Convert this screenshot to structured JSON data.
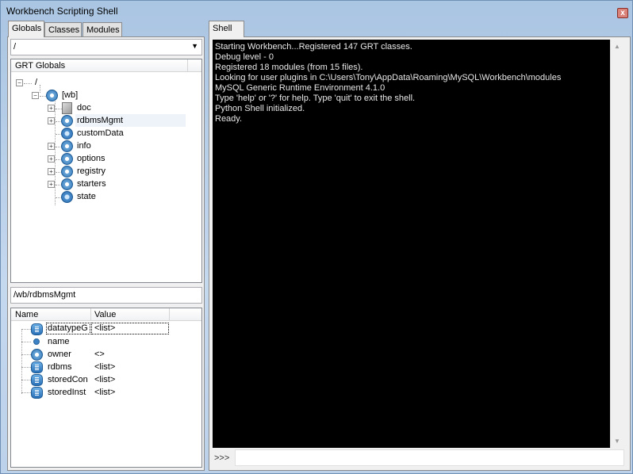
{
  "window": {
    "title": "Workbench Scripting Shell",
    "close_label": "x"
  },
  "left": {
    "tabs": [
      "Globals",
      "Classes",
      "Modules"
    ],
    "path_combo": "/",
    "tree_header": "GRT Globals",
    "tree": [
      {
        "label": "/"
      },
      {
        "label": "[wb]"
      },
      {
        "label": "doc"
      },
      {
        "label": "rdbmsMgmt"
      },
      {
        "label": "customData"
      },
      {
        "label": "info"
      },
      {
        "label": "options"
      },
      {
        "label": "registry"
      },
      {
        "label": "starters"
      },
      {
        "label": "state"
      }
    ],
    "selected_path": "/wb/rdbmsMgmt",
    "props_headers": {
      "name": "Name",
      "value": "Value"
    },
    "props": [
      {
        "name": "datatypeG",
        "value": "<list>"
      },
      {
        "name": "name",
        "value": ""
      },
      {
        "name": "owner",
        "value": "<>"
      },
      {
        "name": "rdbms",
        "value": "<list>"
      },
      {
        "name": "storedCon",
        "value": "<list>"
      },
      {
        "name": "storedInst",
        "value": "<list>"
      }
    ]
  },
  "shell": {
    "tab": "Shell",
    "lines": [
      "Starting Workbench...Registered 147 GRT classes.",
      "Debug level - 0",
      "Registered 18 modules (from 15 files).",
      "Looking for user plugins in C:\\Users\\Tony\\AppData\\Roaming\\MySQL\\Workbench\\modules",
      "MySQL Generic Runtime Environment 4.1.0",
      "Type 'help' or '?' for help. Type 'quit' to exit the shell.",
      "Python Shell initialized.",
      "Ready."
    ],
    "prompt": ">>>",
    "input": ""
  }
}
